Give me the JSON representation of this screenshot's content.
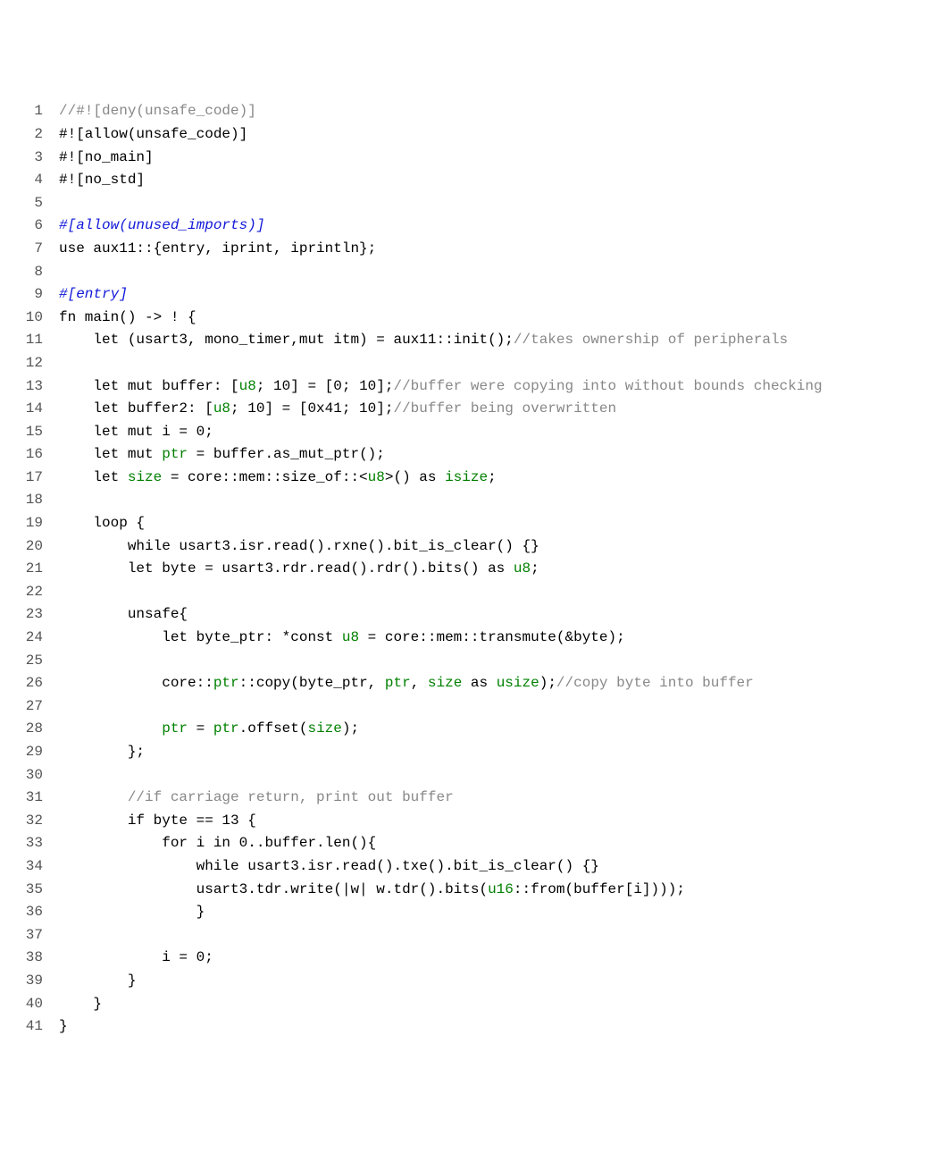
{
  "code": {
    "lines": [
      {
        "n": 1,
        "tokens": [
          {
            "t": "//#![deny(unsafe_code)]",
            "c": "comment"
          }
        ]
      },
      {
        "n": 2,
        "tokens": [
          {
            "t": "#![allow(unsafe_code)]"
          }
        ]
      },
      {
        "n": 3,
        "tokens": [
          {
            "t": "#![no_main]"
          }
        ]
      },
      {
        "n": 4,
        "tokens": [
          {
            "t": "#![no_std]"
          }
        ]
      },
      {
        "n": 5,
        "tokens": [
          {
            "t": ""
          }
        ]
      },
      {
        "n": 6,
        "tokens": [
          {
            "t": "#[allow(unused_imports)]",
            "c": "attr"
          }
        ]
      },
      {
        "n": 7,
        "tokens": [
          {
            "t": "use aux11::{entry, iprint, iprintln};"
          }
        ]
      },
      {
        "n": 8,
        "tokens": [
          {
            "t": ""
          }
        ]
      },
      {
        "n": 9,
        "tokens": [
          {
            "t": "#[entry]",
            "c": "attr"
          }
        ]
      },
      {
        "n": 10,
        "tokens": [
          {
            "t": "fn main() -> ! {"
          }
        ]
      },
      {
        "n": 11,
        "tokens": [
          {
            "t": "    let (usart3, mono_timer,mut itm) = aux11::init();"
          },
          {
            "t": "//takes ownership of peripherals",
            "c": "comment"
          }
        ]
      },
      {
        "n": 12,
        "tokens": [
          {
            "t": ""
          }
        ]
      },
      {
        "n": 13,
        "tokens": [
          {
            "t": "    let mut buffer: ["
          },
          {
            "t": "u8",
            "c": "type"
          },
          {
            "t": "; 10] = [0; 10];"
          },
          {
            "t": "//buffer were copying into without bounds checking",
            "c": "comment"
          }
        ]
      },
      {
        "n": 14,
        "tokens": [
          {
            "t": "    let buffer2: ["
          },
          {
            "t": "u8",
            "c": "type"
          },
          {
            "t": "; 10] = [0x41; 10];"
          },
          {
            "t": "//buffer being overwritten",
            "c": "comment"
          }
        ]
      },
      {
        "n": 15,
        "tokens": [
          {
            "t": "    let mut i = 0;"
          }
        ]
      },
      {
        "n": 16,
        "tokens": [
          {
            "t": "    let mut "
          },
          {
            "t": "ptr",
            "c": "type"
          },
          {
            "t": " = buffer.as_mut_ptr();"
          }
        ]
      },
      {
        "n": 17,
        "tokens": [
          {
            "t": "    let "
          },
          {
            "t": "size",
            "c": "type"
          },
          {
            "t": " = core::mem::size_of::<"
          },
          {
            "t": "u8",
            "c": "type"
          },
          {
            "t": ">() as "
          },
          {
            "t": "isize",
            "c": "type"
          },
          {
            "t": ";"
          }
        ]
      },
      {
        "n": 18,
        "tokens": [
          {
            "t": ""
          }
        ]
      },
      {
        "n": 19,
        "tokens": [
          {
            "t": "    loop {"
          }
        ]
      },
      {
        "n": 20,
        "tokens": [
          {
            "t": "        while usart3.isr.read().rxne().bit_is_clear() {}"
          }
        ]
      },
      {
        "n": 21,
        "tokens": [
          {
            "t": "        let byte = usart3.rdr.read().rdr().bits() as "
          },
          {
            "t": "u8",
            "c": "type"
          },
          {
            "t": ";"
          }
        ]
      },
      {
        "n": 22,
        "tokens": [
          {
            "t": ""
          }
        ]
      },
      {
        "n": 23,
        "tokens": [
          {
            "t": "        unsafe{"
          }
        ]
      },
      {
        "n": 24,
        "tokens": [
          {
            "t": "            let byte_ptr: *const "
          },
          {
            "t": "u8",
            "c": "type"
          },
          {
            "t": " = core::mem::transmute(&byte);"
          }
        ]
      },
      {
        "n": 25,
        "tokens": [
          {
            "t": ""
          }
        ]
      },
      {
        "n": 26,
        "tokens": [
          {
            "t": "            core::"
          },
          {
            "t": "ptr",
            "c": "type"
          },
          {
            "t": "::copy(byte_ptr, "
          },
          {
            "t": "ptr",
            "c": "type"
          },
          {
            "t": ", "
          },
          {
            "t": "size",
            "c": "type"
          },
          {
            "t": " as "
          },
          {
            "t": "usize",
            "c": "type"
          },
          {
            "t": ");"
          },
          {
            "t": "//copy byte into buffer",
            "c": "comment"
          }
        ]
      },
      {
        "n": 27,
        "tokens": [
          {
            "t": ""
          }
        ]
      },
      {
        "n": 28,
        "tokens": [
          {
            "t": "            "
          },
          {
            "t": "ptr",
            "c": "type"
          },
          {
            "t": " = "
          },
          {
            "t": "ptr",
            "c": "type"
          },
          {
            "t": ".offset("
          },
          {
            "t": "size",
            "c": "type"
          },
          {
            "t": ");"
          }
        ]
      },
      {
        "n": 29,
        "tokens": [
          {
            "t": "        };"
          }
        ]
      },
      {
        "n": 30,
        "tokens": [
          {
            "t": ""
          }
        ]
      },
      {
        "n": 31,
        "tokens": [
          {
            "t": "        "
          },
          {
            "t": "//if carriage return, print out buffer",
            "c": "comment"
          }
        ]
      },
      {
        "n": 32,
        "tokens": [
          {
            "t": "        if byte == 13 {"
          }
        ]
      },
      {
        "n": 33,
        "tokens": [
          {
            "t": "            for i in 0..buffer.len(){"
          }
        ]
      },
      {
        "n": 34,
        "tokens": [
          {
            "t": "                while usart3.isr.read().txe().bit_is_clear() {}"
          }
        ]
      },
      {
        "n": 35,
        "tokens": [
          {
            "t": "                usart3.tdr.write(|w| w.tdr().bits("
          },
          {
            "t": "u16",
            "c": "type"
          },
          {
            "t": "::from(buffer[i])));"
          }
        ]
      },
      {
        "n": 36,
        "tokens": [
          {
            "t": "                }"
          }
        ]
      },
      {
        "n": 37,
        "tokens": [
          {
            "t": ""
          }
        ]
      },
      {
        "n": 38,
        "tokens": [
          {
            "t": "            i = 0;"
          }
        ]
      },
      {
        "n": 39,
        "tokens": [
          {
            "t": "        }"
          }
        ]
      },
      {
        "n": 40,
        "tokens": [
          {
            "t": "    }"
          }
        ]
      },
      {
        "n": 41,
        "tokens": [
          {
            "t": "}"
          }
        ]
      }
    ]
  }
}
